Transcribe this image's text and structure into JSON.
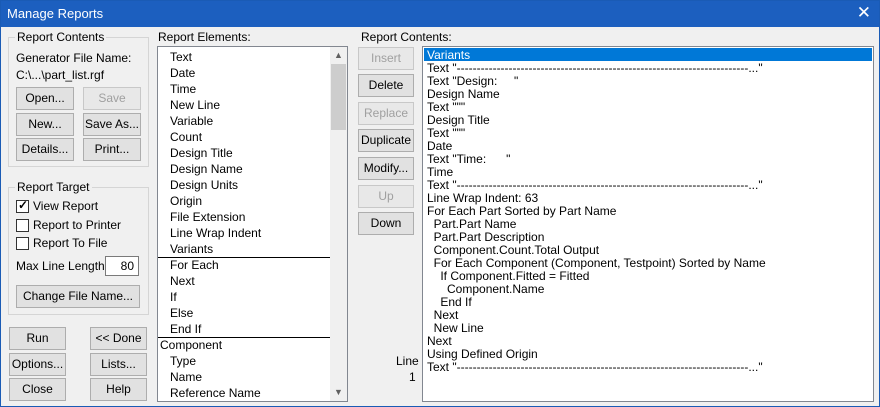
{
  "window": {
    "title": "Manage Reports"
  },
  "report_contents_group": {
    "legend": "Report Contents",
    "generator_label": "Generator File Name:",
    "file_path": "C:\\...\\part_list.rgf",
    "buttons": {
      "open": "Open...",
      "save": "Save",
      "new": "New...",
      "save_as": "Save As...",
      "details": "Details...",
      "print": "Print..."
    }
  },
  "report_target_group": {
    "legend": "Report Target",
    "view_report": "View Report",
    "report_to_printer": "Report to Printer",
    "report_to_file": "Report To File",
    "max_line_length_label": "Max Line Length:",
    "max_line_length": "80",
    "change_file_name": "Change File Name..."
  },
  "bottom_buttons": {
    "run": "Run",
    "done": "<< Done",
    "options": "Options...",
    "lists": "Lists...",
    "close": "Close",
    "help": "Help"
  },
  "report_elements": {
    "label": "Report Elements:",
    "items": [
      "Text",
      "Date",
      "Time",
      "New Line",
      "Variable",
      "Count",
      "Design Title",
      "Design Name",
      "Design Units",
      "Origin",
      "File Extension",
      "Line Wrap Indent",
      "Variants",
      "For Each",
      "Next",
      "If",
      "Else",
      "End If",
      "Component",
      "Type",
      "Name",
      "Reference Name"
    ]
  },
  "middle_buttons": {
    "insert": "Insert",
    "delete": "Delete",
    "replace": "Replace",
    "duplicate": "Duplicate",
    "modify": "Modify...",
    "up": "Up",
    "down": "Down"
  },
  "line_indicator": {
    "label": "Line",
    "value": "1"
  },
  "report_contents": {
    "label": "Report Contents:",
    "items": [
      "Variants",
      "Text \"-------------------------------------------------------------------------...\"",
      "Text \"Design:     \"",
      "Design Name",
      "Text \"\"\"",
      "Design Title",
      "Text \"\"\"",
      "Date",
      "Text \"Time:      \"",
      "Time",
      "Text \"-------------------------------------------------------------------------...\"",
      "Line Wrap Indent: 63",
      "For Each Part Sorted by Part Name",
      "  Part.Part Name",
      "  Part.Part Description",
      "  Component.Count.Total Output",
      "  For Each Component (Component, Testpoint) Sorted by Name",
      "    If Component.Fitted = Fitted",
      "      Component.Name",
      "    End If",
      "  Next",
      "  New Line",
      "Next",
      "Using Defined Origin",
      "Text \"-------------------------------------------------------------------------...\""
    ]
  }
}
